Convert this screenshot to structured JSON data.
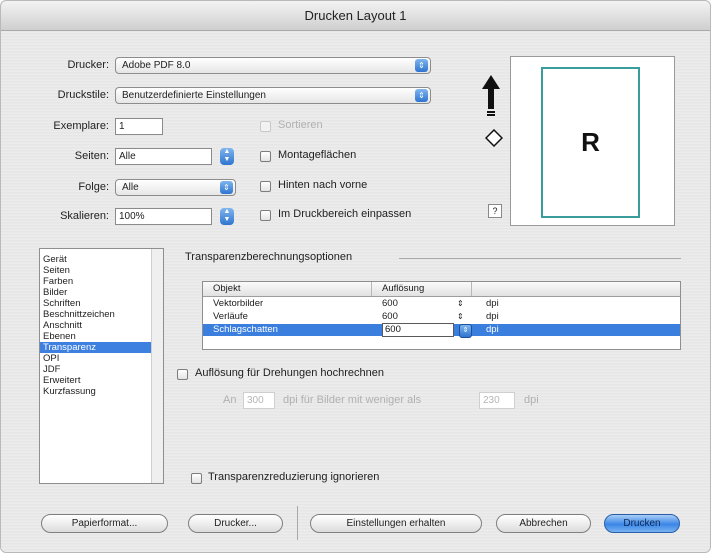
{
  "window": {
    "title": "Drucken Layout 1"
  },
  "top": {
    "printer_label": "Drucker:",
    "printer_value": "Adobe PDF 8.0",
    "style_label": "Druckstile:",
    "style_value": "Benutzerdefinierte Einstellungen",
    "copies_label": "Exemplare:",
    "copies_value": "1",
    "pages_label": "Seiten:",
    "pages_value": "Alle",
    "sequence_label": "Folge:",
    "sequence_value": "Alle",
    "scale_label": "Skalieren:",
    "scale_value": "100%"
  },
  "options": {
    "collate": "Sortieren",
    "spreads": "Montageflächen",
    "back_to_front": "Hinten nach vorne",
    "fit_to_area": "Im Druckbereich einpassen"
  },
  "preview": {
    "letter": "R",
    "corner_icon": "?"
  },
  "categories": {
    "items": [
      "Gerät",
      "Seiten",
      "Farben",
      "Bilder",
      "Schriften",
      "Beschnittzeichen",
      "Anschnitt",
      "Ebenen",
      "Transparenz",
      "OPI",
      "JDF",
      "Erweitert",
      "Kurzfassung"
    ],
    "selected_index": 8
  },
  "transparency": {
    "group_title": "Transparenzberechnungsoptionen",
    "headers": [
      "Objekt",
      "Auflösung"
    ],
    "rows": [
      {
        "object": "Vektorbilder",
        "resolution": "600",
        "unit": "dpi"
      },
      {
        "object": "Verläufe",
        "resolution": "600",
        "unit": "dpi"
      },
      {
        "object": "Schlagschatten",
        "resolution": "600",
        "unit": "dpi"
      }
    ],
    "selected_row": 2,
    "upsample_label": "Auflösung für Drehungen hochrechnen",
    "at_label": "An",
    "at_value": "300",
    "dpi_for_images": "dpi für Bilder mit weniger als",
    "less_value": "230",
    "dpi_suffix": "dpi",
    "ignore_label": "Transparenzreduzierung ignorieren"
  },
  "buttons": {
    "page_setup": "Papierformat...",
    "printer": "Drucker...",
    "keep_settings": "Einstellungen erhalten",
    "cancel": "Abbrechen",
    "print": "Drucken"
  }
}
